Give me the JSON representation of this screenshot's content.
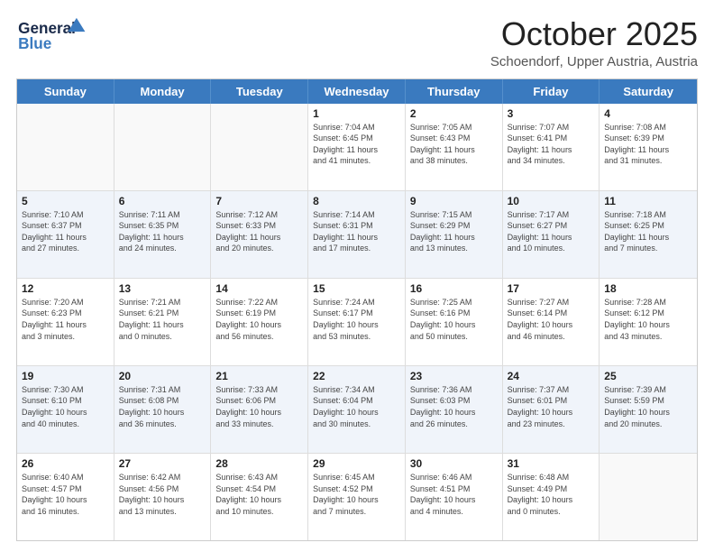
{
  "header": {
    "logo_general": "General",
    "logo_blue": "Blue",
    "month": "October 2025",
    "location": "Schoendorf, Upper Austria, Austria"
  },
  "weekdays": [
    "Sunday",
    "Monday",
    "Tuesday",
    "Wednesday",
    "Thursday",
    "Friday",
    "Saturday"
  ],
  "rows": [
    [
      {
        "day": "",
        "info": ""
      },
      {
        "day": "",
        "info": ""
      },
      {
        "day": "",
        "info": ""
      },
      {
        "day": "1",
        "info": "Sunrise: 7:04 AM\nSunset: 6:45 PM\nDaylight: 11 hours\nand 41 minutes."
      },
      {
        "day": "2",
        "info": "Sunrise: 7:05 AM\nSunset: 6:43 PM\nDaylight: 11 hours\nand 38 minutes."
      },
      {
        "day": "3",
        "info": "Sunrise: 7:07 AM\nSunset: 6:41 PM\nDaylight: 11 hours\nand 34 minutes."
      },
      {
        "day": "4",
        "info": "Sunrise: 7:08 AM\nSunset: 6:39 PM\nDaylight: 11 hours\nand 31 minutes."
      }
    ],
    [
      {
        "day": "5",
        "info": "Sunrise: 7:10 AM\nSunset: 6:37 PM\nDaylight: 11 hours\nand 27 minutes."
      },
      {
        "day": "6",
        "info": "Sunrise: 7:11 AM\nSunset: 6:35 PM\nDaylight: 11 hours\nand 24 minutes."
      },
      {
        "day": "7",
        "info": "Sunrise: 7:12 AM\nSunset: 6:33 PM\nDaylight: 11 hours\nand 20 minutes."
      },
      {
        "day": "8",
        "info": "Sunrise: 7:14 AM\nSunset: 6:31 PM\nDaylight: 11 hours\nand 17 minutes."
      },
      {
        "day": "9",
        "info": "Sunrise: 7:15 AM\nSunset: 6:29 PM\nDaylight: 11 hours\nand 13 minutes."
      },
      {
        "day": "10",
        "info": "Sunrise: 7:17 AM\nSunset: 6:27 PM\nDaylight: 11 hours\nand 10 minutes."
      },
      {
        "day": "11",
        "info": "Sunrise: 7:18 AM\nSunset: 6:25 PM\nDaylight: 11 hours\nand 7 minutes."
      }
    ],
    [
      {
        "day": "12",
        "info": "Sunrise: 7:20 AM\nSunset: 6:23 PM\nDaylight: 11 hours\nand 3 minutes."
      },
      {
        "day": "13",
        "info": "Sunrise: 7:21 AM\nSunset: 6:21 PM\nDaylight: 11 hours\nand 0 minutes."
      },
      {
        "day": "14",
        "info": "Sunrise: 7:22 AM\nSunset: 6:19 PM\nDaylight: 10 hours\nand 56 minutes."
      },
      {
        "day": "15",
        "info": "Sunrise: 7:24 AM\nSunset: 6:17 PM\nDaylight: 10 hours\nand 53 minutes."
      },
      {
        "day": "16",
        "info": "Sunrise: 7:25 AM\nSunset: 6:16 PM\nDaylight: 10 hours\nand 50 minutes."
      },
      {
        "day": "17",
        "info": "Sunrise: 7:27 AM\nSunset: 6:14 PM\nDaylight: 10 hours\nand 46 minutes."
      },
      {
        "day": "18",
        "info": "Sunrise: 7:28 AM\nSunset: 6:12 PM\nDaylight: 10 hours\nand 43 minutes."
      }
    ],
    [
      {
        "day": "19",
        "info": "Sunrise: 7:30 AM\nSunset: 6:10 PM\nDaylight: 10 hours\nand 40 minutes."
      },
      {
        "day": "20",
        "info": "Sunrise: 7:31 AM\nSunset: 6:08 PM\nDaylight: 10 hours\nand 36 minutes."
      },
      {
        "day": "21",
        "info": "Sunrise: 7:33 AM\nSunset: 6:06 PM\nDaylight: 10 hours\nand 33 minutes."
      },
      {
        "day": "22",
        "info": "Sunrise: 7:34 AM\nSunset: 6:04 PM\nDaylight: 10 hours\nand 30 minutes."
      },
      {
        "day": "23",
        "info": "Sunrise: 7:36 AM\nSunset: 6:03 PM\nDaylight: 10 hours\nand 26 minutes."
      },
      {
        "day": "24",
        "info": "Sunrise: 7:37 AM\nSunset: 6:01 PM\nDaylight: 10 hours\nand 23 minutes."
      },
      {
        "day": "25",
        "info": "Sunrise: 7:39 AM\nSunset: 5:59 PM\nDaylight: 10 hours\nand 20 minutes."
      }
    ],
    [
      {
        "day": "26",
        "info": "Sunrise: 6:40 AM\nSunset: 4:57 PM\nDaylight: 10 hours\nand 16 minutes."
      },
      {
        "day": "27",
        "info": "Sunrise: 6:42 AM\nSunset: 4:56 PM\nDaylight: 10 hours\nand 13 minutes."
      },
      {
        "day": "28",
        "info": "Sunrise: 6:43 AM\nSunset: 4:54 PM\nDaylight: 10 hours\nand 10 minutes."
      },
      {
        "day": "29",
        "info": "Sunrise: 6:45 AM\nSunset: 4:52 PM\nDaylight: 10 hours\nand 7 minutes."
      },
      {
        "day": "30",
        "info": "Sunrise: 6:46 AM\nSunset: 4:51 PM\nDaylight: 10 hours\nand 4 minutes."
      },
      {
        "day": "31",
        "info": "Sunrise: 6:48 AM\nSunset: 4:49 PM\nDaylight: 10 hours\nand 0 minutes."
      },
      {
        "day": "",
        "info": ""
      }
    ]
  ]
}
